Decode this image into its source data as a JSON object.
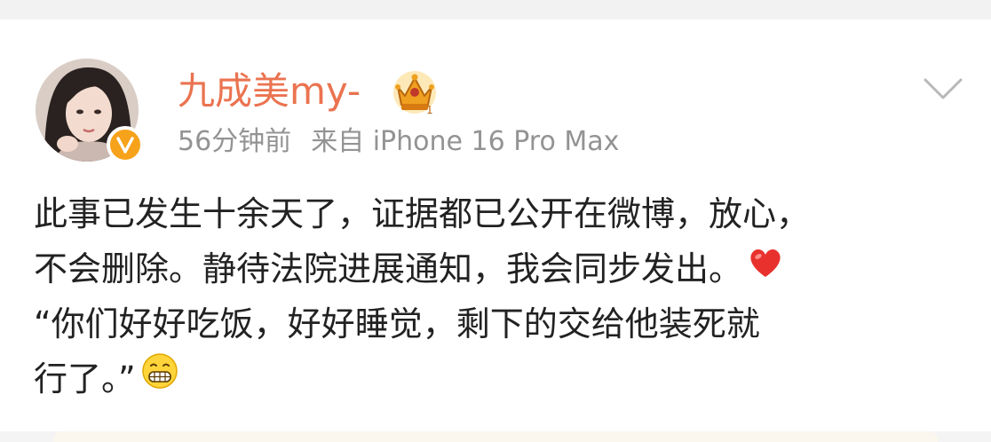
{
  "post": {
    "user": {
      "name": "九成美my-",
      "avatar_icon": "avatar-photo",
      "verified_icon": "verified-v-icon",
      "vip_icon": "crown-icon",
      "name_color": "#eb7350"
    },
    "meta": {
      "time": "56分钟前",
      "source": "来自 iPhone 16 Pro Max"
    },
    "menu_icon": "chevron-down-icon",
    "content": {
      "line1": "此事已发生十余天了，证据都已公开在微博，放心，",
      "line2": "不会删除。静待法院进展通知，我会同步发出。",
      "line3": "“你们好好吃饭，好好睡觉，剩下的交给他装死就",
      "line4": "行了。”",
      "emoji_heart": "heart-emoji",
      "emoji_grin": "grin-emoji"
    }
  }
}
